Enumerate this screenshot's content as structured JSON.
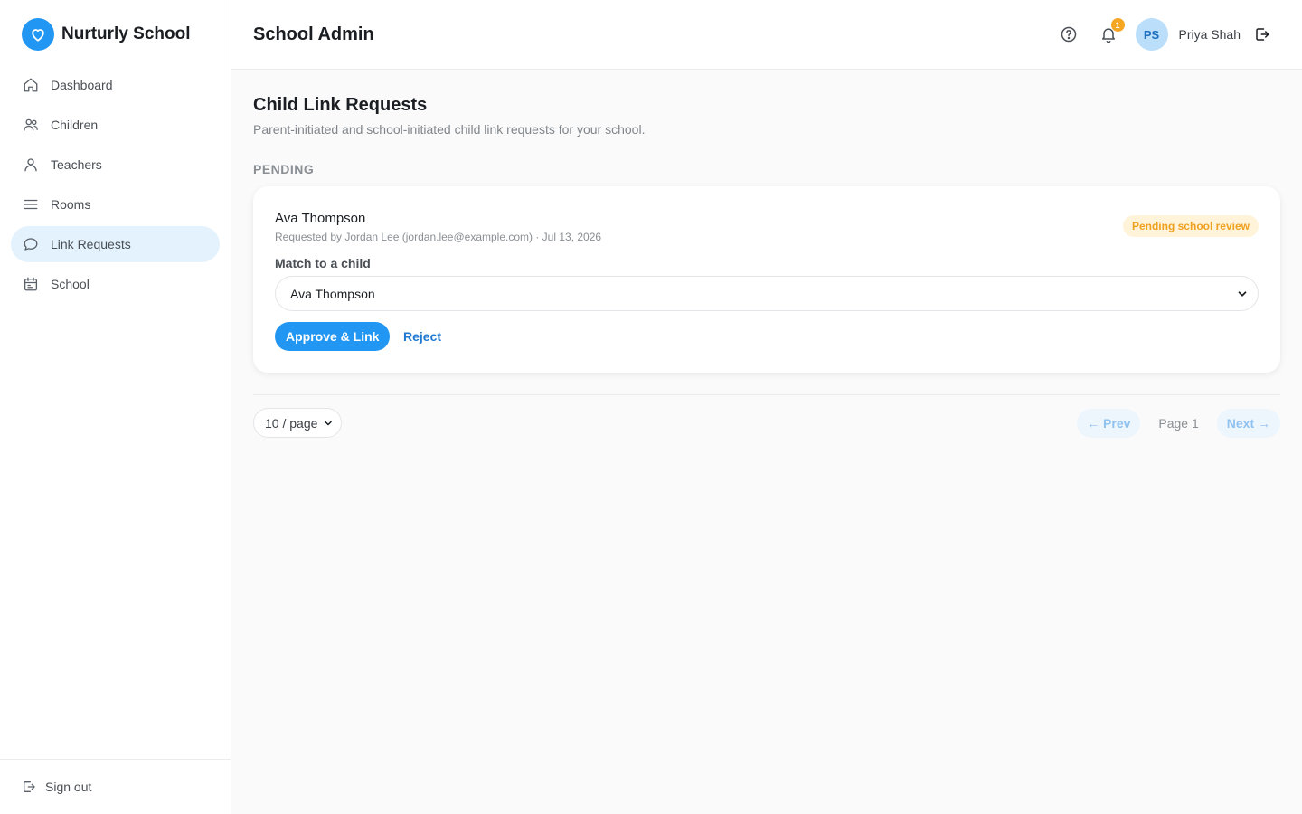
{
  "brand": {
    "name": "Nurturly School",
    "color": "#2196f3"
  },
  "sidebar": {
    "items": [
      {
        "label": "Dashboard",
        "icon": "home-icon",
        "active": false
      },
      {
        "label": "Children",
        "icon": "users-icon",
        "active": false
      },
      {
        "label": "Teachers",
        "icon": "user-icon",
        "active": false
      },
      {
        "label": "Rooms",
        "icon": "menu-icon",
        "active": false
      },
      {
        "label": "Link Requests",
        "icon": "chat-bubble-icon",
        "active": true
      },
      {
        "label": "School",
        "icon": "calendar-icon",
        "active": false
      }
    ],
    "sign_out": "Sign out"
  },
  "header": {
    "title": "School Admin",
    "notification_count": "1",
    "user_initials": "PS",
    "user_name": "Priya Shah"
  },
  "main": {
    "title": "Child Link Requests",
    "subtitle": "Parent-initiated and school-initiated child link requests for your school.",
    "section_label": "PENDING",
    "request": {
      "child_name": "Ava Thompson",
      "meta": "Requested by Jordan Lee (jordan.lee@example.com) · Jul 13, 2026",
      "status": "Pending school review",
      "match_label": "Match to a child",
      "selected_child": "Ava Thompson",
      "approve_label": "Approve & Link",
      "reject_label": "Reject"
    },
    "pagination": {
      "per_page": "10 / page",
      "prev_label": "← Prev",
      "page_label": "Page 1",
      "next_label": "Next →"
    }
  }
}
